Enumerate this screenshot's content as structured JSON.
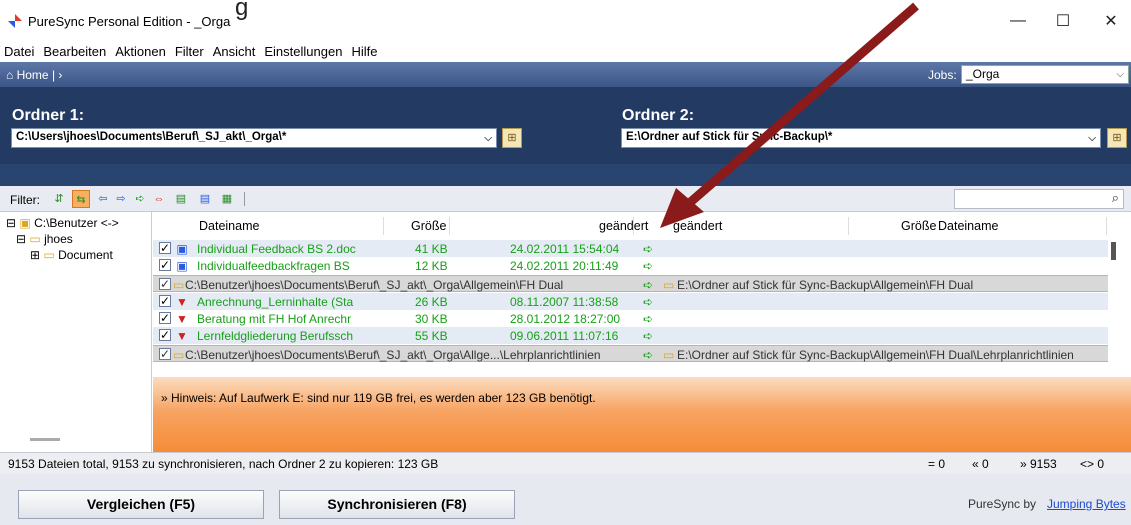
{
  "window": {
    "title": "PureSync Personal Edition - _Orga",
    "caption_fragment": "g",
    "minimize": "—",
    "maximize": "☐",
    "close": "✕"
  },
  "menu": [
    "Datei",
    "Bearbeiten",
    "Aktionen",
    "Filter",
    "Ansicht",
    "Einstellungen",
    "Hilfe"
  ],
  "nav": {
    "home": "Home",
    "sep": "|  ›",
    "jobs_label": "Jobs:",
    "jobs_value": "_Orga"
  },
  "folder1": {
    "label": "Ordner 1:",
    "path": "C:\\Users\\jhoes\\Documents\\Beruf\\_SJ_akt\\_Orga\\*"
  },
  "folder2": {
    "label": "Ordner 2:",
    "path": "E:\\Ordner auf Stick für Sync-Backup\\*"
  },
  "filter": {
    "label": "Filter:",
    "search_placeholder": ""
  },
  "tree": [
    {
      "label": "C:\\Benutzer <->",
      "prefix": "⊟"
    },
    {
      "label": "jhoes",
      "prefix": "⊟"
    },
    {
      "label": "Document",
      "prefix": "⊞"
    }
  ],
  "columns": {
    "left_name": "Dateiname",
    "left_size": "Größe",
    "left_changed": "geändert",
    "right_changed": "geändert",
    "right_size": "Größe",
    "right_name": "Dateiname"
  },
  "rows": [
    {
      "type": "file",
      "name": "Individual Feedback BS 2.doc",
      "size": "41 KB",
      "changed": "24.02.2011 15:54:04",
      "icon": "word-icon"
    },
    {
      "type": "file",
      "name": "Individualfeedbackfragen BS",
      "size": "12 KB",
      "changed": "24.02.2011 20:11:49",
      "icon": "word-icon"
    },
    {
      "type": "folder",
      "left": "C:\\Benutzer\\jhoes\\Documents\\Beruf\\_SJ_akt\\_Orga\\Allgemein\\FH Dual",
      "right": "E:\\Ordner auf Stick für Sync-Backup\\Allgemein\\FH Dual"
    },
    {
      "type": "file",
      "name": "Anrechnung_Lerninhalte (Sta",
      "size": "26 KB",
      "changed": "08.11.2007 11:38:58",
      "icon": "pdf-icon"
    },
    {
      "type": "file",
      "name": "Beratung mit FH Hof Anrechr",
      "size": "30 KB",
      "changed": "28.01.2012 18:27:00",
      "icon": "pdf-icon"
    },
    {
      "type": "file",
      "name": "Lernfeldgliederung Berufssch",
      "size": "55 KB",
      "changed": "09.06.2011 11:07:16",
      "icon": "pdf-icon"
    },
    {
      "type": "folder",
      "left": "C:\\Benutzer\\jhoes\\Documents\\Beruf\\_SJ_akt\\_Orga\\Allge...\\Lehrplanrichtlinien",
      "right": "E:\\Ordner auf Stick für Sync-Backup\\Allgemein\\FH Dual\\Lehrplanrichtlinien"
    }
  ],
  "hint": "» Hinweis: Auf Laufwerk E: sind nur 119 GB frei, es werden aber 123 GB benötigt.",
  "status": {
    "summary": "9153 Dateien total,  9153 zu synchronisieren,  nach Ordner 2 zu kopieren: 123 GB",
    "eq": "= 0",
    "left": "« 0",
    "right": "» 9153",
    "diff": "<> 0"
  },
  "buttons": {
    "compare": "Vergleichen (F5)",
    "sync": "Synchronisieren (F8)"
  },
  "footer": {
    "by": "PureSync by",
    "link": "Jumping Bytes"
  },
  "colors": {
    "dark_panel": "#233a63",
    "green_text": "#18a018",
    "hint_orange": "#f58c38",
    "red_arrow": "#8b1a1a"
  }
}
